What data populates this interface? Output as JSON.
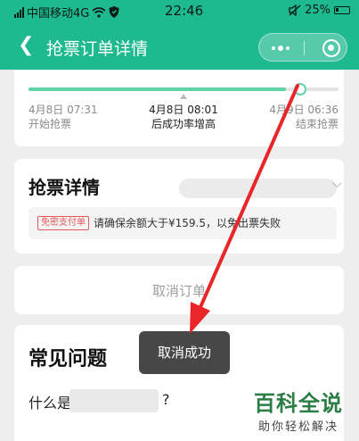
{
  "status_bar": {
    "carrier": "中国移动4G",
    "time": "22:46",
    "battery": "25%"
  },
  "nav": {
    "title": "抢票订单详情"
  },
  "timeline": {
    "progress_fraction": 0.83,
    "start": {
      "time": "4月8日 07:31",
      "label": "开始抢票"
    },
    "middle": {
      "time": "4月8日 08:01",
      "label": "后成功率增高"
    },
    "end": {
      "time": "4月9日 06:36",
      "label": "结束抢票"
    }
  },
  "detail": {
    "title": "抢票详情",
    "tag": "免密支付单",
    "notice": "请确保余额大于¥159.5，以免出票失败"
  },
  "cancel": {
    "label": "取消订单"
  },
  "faq": {
    "title": "常见问题",
    "question_prefix": "什么是",
    "question_suffix": "?"
  },
  "toast": {
    "text": "取消成功"
  },
  "watermark": {
    "title": "百科全说",
    "subtitle": "助你轻松解决"
  },
  "colors": {
    "primary": "#1fb98f",
    "progress": "#5fd3a8",
    "tag_red": "#e45a5a",
    "arrow_red": "#e8262a"
  }
}
